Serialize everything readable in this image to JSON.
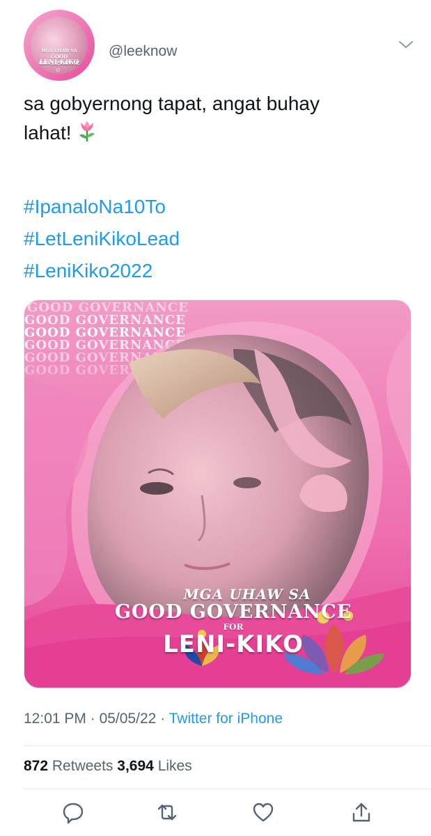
{
  "tweet": {
    "handle": "@leeknow",
    "text_line1": "sa gobyernong tapat, angat buhay",
    "text_line2": "lahat!",
    "emoji": "tulip-icon",
    "hashtags": [
      "#IpanaloNa10To",
      "#LetLeniKikoLead",
      "#LeniKiko2022"
    ],
    "time": "12:01 PM",
    "date": "05/05/22",
    "source": "Twitter for iPhone",
    "retweets_count": "872",
    "retweets_label": "Retweets",
    "likes_count": "3,694",
    "likes_label": "Likes"
  },
  "media": {
    "banner_text": "GOOD GOVERNANCE",
    "caption_line1": "MGA UHAW SA",
    "caption_line2": "GOOD GOVERNANCE",
    "caption_line3": "FOR",
    "caption_line4": "LENI-KIKO"
  },
  "avatar": {
    "line1": "MGA UHAW SA",
    "line2": "GOOD GOVERNANCE",
    "line3": "LENI-KIKO"
  },
  "colors": {
    "link": "#1d9bf0",
    "muted": "#536471",
    "pink": "#e44598"
  },
  "actions": [
    "reply-icon",
    "retweet-icon",
    "like-icon",
    "share-icon"
  ]
}
